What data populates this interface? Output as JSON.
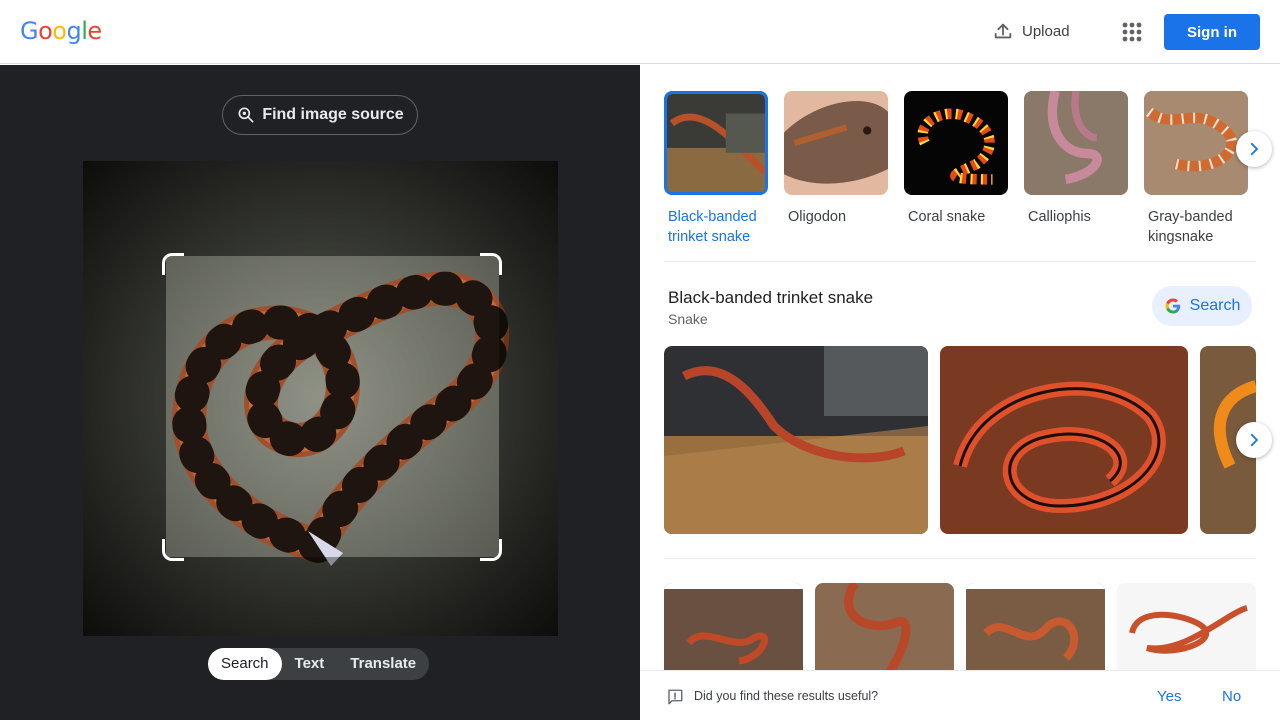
{
  "header": {
    "logo_letters": [
      {
        "ch": "G",
        "color": "#4285F4"
      },
      {
        "ch": "o",
        "color": "#EA4335"
      },
      {
        "ch": "o",
        "color": "#FBBC05"
      },
      {
        "ch": "g",
        "color": "#4285F4"
      },
      {
        "ch": "l",
        "color": "#34A853"
      },
      {
        "ch": "e",
        "color": "#EA4335"
      }
    ],
    "upload_label": "Upload",
    "upload_icon": "upload-icon",
    "apps_icon": "apps-grid-icon",
    "signin_label": "Sign in"
  },
  "left": {
    "find_source_label": "Find image source",
    "find_source_icon": "lens-search-icon",
    "tabs": [
      "Search",
      "Text",
      "Translate"
    ],
    "active_tab": "Search"
  },
  "results": {
    "candidates": [
      {
        "label": "Black-banded trinket snake",
        "selected": true
      },
      {
        "label": "Oligodon",
        "selected": false
      },
      {
        "label": "Coral snake",
        "selected": false
      },
      {
        "label": "Calliophis",
        "selected": false
      },
      {
        "label": "Gray-banded kingsnake",
        "selected": false
      }
    ],
    "entity": {
      "title": "Black-banded trinket snake",
      "subtitle": "Snake",
      "search_label": "Search"
    }
  },
  "feedback": {
    "question": "Did you find these results useful?",
    "yes": "Yes",
    "no": "No"
  },
  "colors": {
    "accent": "#1a73e8",
    "dark_bg": "#202124"
  }
}
